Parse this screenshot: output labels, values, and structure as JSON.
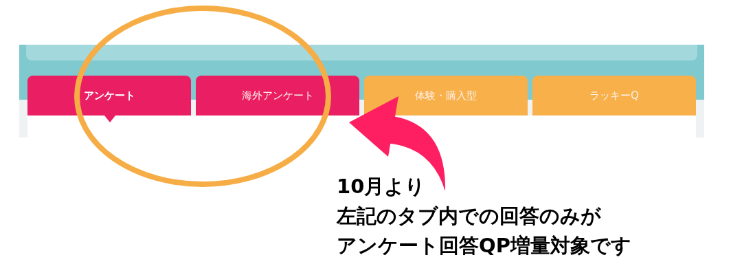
{
  "tabs": [
    {
      "label": "アンケート",
      "selected": true,
      "color": "#ea1e63"
    },
    {
      "label": "海外アンケート",
      "selected": false,
      "color": "#ea1e63"
    },
    {
      "label": "体験・購入型",
      "selected": false,
      "color": "#f8b04b"
    },
    {
      "label": "ラッキーQ",
      "selected": false,
      "color": "#f8b04b"
    }
  ],
  "annotation": {
    "lines": [
      "10月より",
      "左記のタブ内での回答のみが",
      "アンケート回答QP増量対象です"
    ]
  }
}
